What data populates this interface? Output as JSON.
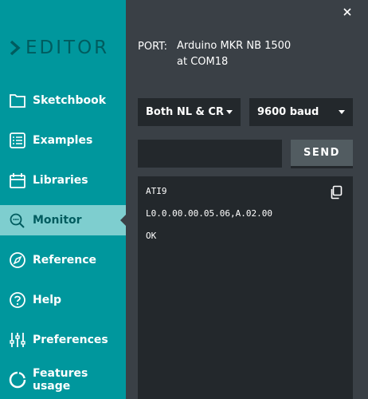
{
  "logo": {
    "text": "EDITOR"
  },
  "sidebar": {
    "items": [
      {
        "label": "Sketchbook",
        "icon": "folder-icon"
      },
      {
        "label": "Examples",
        "icon": "list-icon"
      },
      {
        "label": "Libraries",
        "icon": "library-icon"
      },
      {
        "label": "Monitor",
        "icon": "monitor-search-icon",
        "active": true
      },
      {
        "label": "Reference",
        "icon": "compass-icon"
      },
      {
        "label": "Help",
        "icon": "help-icon"
      },
      {
        "label": "Preferences",
        "icon": "sliders-icon"
      },
      {
        "label": "Features usage",
        "icon": "pie-icon"
      }
    ]
  },
  "panel": {
    "close_icon": "close-icon",
    "port_label": "PORT:",
    "port_value_line1": "Arduino MKR NB 1500",
    "port_value_line2": "at COM18",
    "line_ending": "Both NL & CR",
    "baud_rate": "9600 baud",
    "message_value": "",
    "send_label": "SEND",
    "output_lines": [
      "ATI9",
      "L0.0.00.00.05.06,A.02.00",
      "OK"
    ],
    "copy_icon": "copy-icon"
  },
  "colors": {
    "sidebar_bg": "#00979d",
    "sidebar_active": "#7ececf",
    "panel_bg": "#3a4046",
    "input_bg": "#23282c",
    "logo_color": "#005c5f"
  }
}
